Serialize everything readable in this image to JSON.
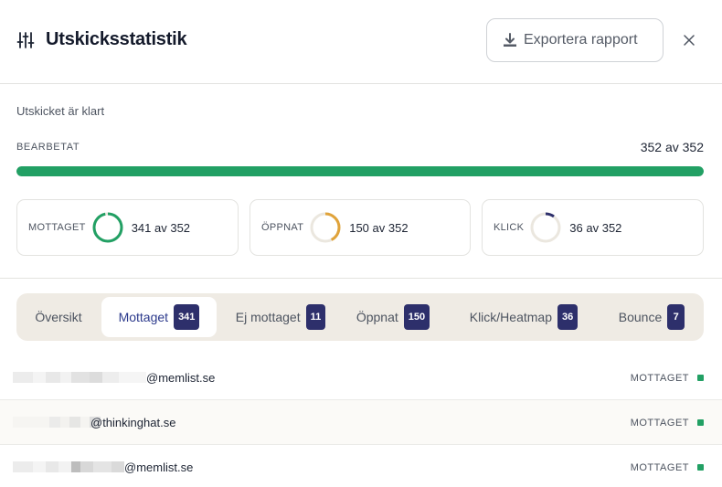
{
  "header": {
    "title": "Utskicksstatistik",
    "title_icon": "sliders-icon",
    "export_label": "Exportera rapport",
    "export_icon": "download-icon",
    "close_icon": "close-icon"
  },
  "status": {
    "text": "Utskicket är klart",
    "processed_label": "BEARBETAT",
    "processed_value": "352 av 352",
    "progress_fraction": 1.0
  },
  "stats": [
    {
      "label": "MOTTAGET",
      "value": "341 av 352",
      "fraction": 0.969,
      "color": "#22a064"
    },
    {
      "label": "ÖPPNAT",
      "value": "150 av 352",
      "fraction": 0.426,
      "color": "#e0a33a"
    },
    {
      "label": "KLICK",
      "value": "36 av 352",
      "fraction": 0.102,
      "color": "#2d2f6b"
    }
  ],
  "tabs": [
    {
      "label": "Översikt",
      "badge": ""
    },
    {
      "label": "Mottaget",
      "badge": "341"
    },
    {
      "label": "Ej mottaget",
      "badge": "11"
    },
    {
      "label": "Öppnat",
      "badge": "150"
    },
    {
      "label": "Klick/Heatmap",
      "badge": "36"
    },
    {
      "label": "Bounce",
      "badge": "7"
    }
  ],
  "rows": [
    {
      "email_suffix": "@memlist.se",
      "status": "MOTTAGET"
    },
    {
      "email_suffix": "@thinkinghat.se",
      "status": "MOTTAGET"
    },
    {
      "email_suffix": "@memlist.se",
      "status": "MOTTAGET"
    }
  ],
  "colors": {
    "accent_green": "#22a064",
    "badge_bg": "#2d2f6b",
    "active_tab_text": "#2c3a8c"
  }
}
